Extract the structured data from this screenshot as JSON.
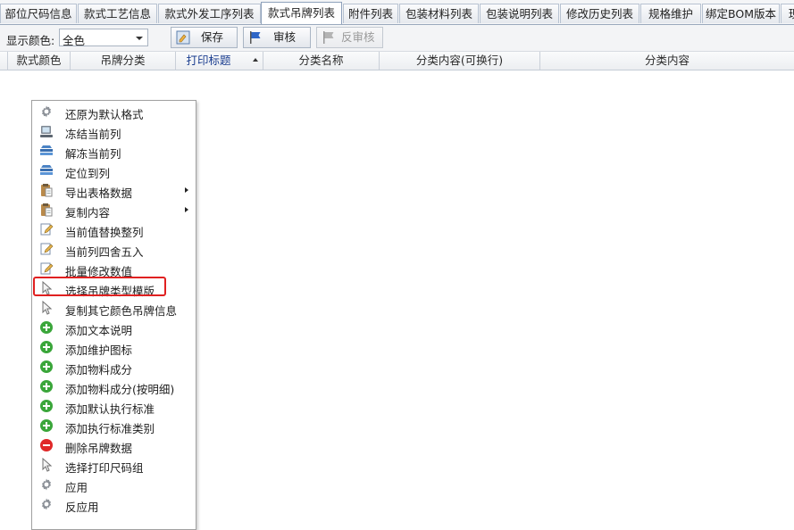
{
  "tabs": [
    {
      "label": "部位尺码信息"
    },
    {
      "label": "款式工艺信息"
    },
    {
      "label": "款式外发工序列表"
    },
    {
      "label": "款式吊牌列表"
    },
    {
      "label": "附件列表"
    },
    {
      "label": "包装材料列表"
    },
    {
      "label": "包装说明列表"
    },
    {
      "label": "修改历史列表"
    },
    {
      "label": "规格维护"
    },
    {
      "label": "绑定BOM版本"
    },
    {
      "label": "现"
    }
  ],
  "active_tab": "款式吊牌列表",
  "toolbar": {
    "color_label": "显示颜色:",
    "color_value": "全色",
    "save_label": "保存",
    "audit_label": "审核",
    "unaudit_label": "反审核"
  },
  "grid": {
    "columns": [
      {
        "label": "款式颜色"
      },
      {
        "label": "吊牌分类"
      },
      {
        "label": "打印标题"
      },
      {
        "label": "分类名称"
      },
      {
        "label": "分类内容(可换行)"
      },
      {
        "label": "分类内容"
      }
    ],
    "sorted_column": "打印标题"
  },
  "context_menu": {
    "items": [
      {
        "label": "还原为默认格式",
        "icon": "gear-icon"
      },
      {
        "label": "冻结当前列",
        "icon": "freeze-icon"
      },
      {
        "label": "解冻当前列",
        "icon": "stack-icon"
      },
      {
        "label": "定位到列",
        "icon": "stack-icon"
      },
      {
        "label": "导出表格数据",
        "icon": "clipboard-icon"
      },
      {
        "label": "复制内容",
        "icon": "clipboard-icon"
      },
      {
        "label": "当前值替换整列",
        "icon": "edit-icon"
      },
      {
        "label": "当前列四舍五入",
        "icon": "edit-icon"
      },
      {
        "label": "批量修改数值",
        "icon": "edit-icon"
      },
      {
        "label": "选择吊牌类型模版",
        "icon": "cursor-icon"
      },
      {
        "label": "复制其它颜色吊牌信息",
        "icon": "cursor-icon"
      },
      {
        "label": "添加文本说明",
        "icon": "add-icon"
      },
      {
        "label": "添加维护图标",
        "icon": "add-icon"
      },
      {
        "label": "添加物料成分",
        "icon": "add-icon"
      },
      {
        "label": "添加物料成分(按明细)",
        "icon": "add-icon"
      },
      {
        "label": "添加默认执行标准",
        "icon": "add-icon"
      },
      {
        "label": "添加执行标准类别",
        "icon": "add-icon"
      },
      {
        "label": "删除吊牌数据",
        "icon": "remove-icon"
      },
      {
        "label": "选择打印尺码组",
        "icon": "cursor-icon"
      },
      {
        "label": "应用",
        "icon": "gear-icon"
      },
      {
        "label": "反应用",
        "icon": "gear-icon"
      }
    ],
    "highlighted_item": "选择吊牌类型模版"
  },
  "colors": {
    "highlight_border": "#e02020",
    "add_icon": "#3aa63a",
    "remove_icon": "#e02828"
  }
}
